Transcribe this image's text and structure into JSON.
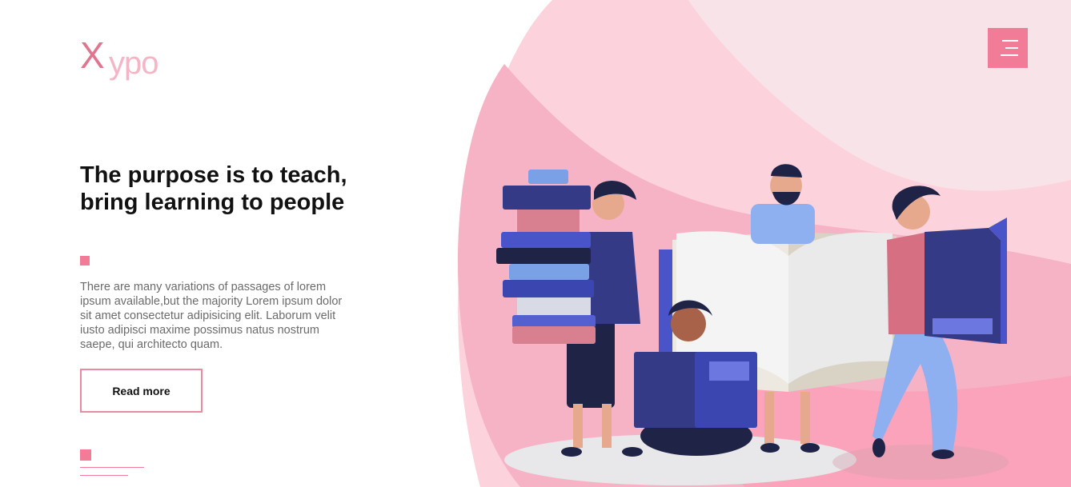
{
  "header": {
    "logo": {
      "letter": "X",
      "rest": "ypo"
    },
    "menu_icon": "hamburger-menu-icon"
  },
  "hero": {
    "title": "The purpose is to teach, bring learning to people",
    "description": "There are many variations of passages of lorem ipsum available,but the majority Lorem ipsum dolor sit amet consectetur adipisicing elit. Laborum velit iusto adipisci maxime possimus natus nostrum saepe, qui architecto quam.",
    "read_more_label": "Read more"
  },
  "colors": {
    "accent": "#f27c98",
    "blob_light": "#f8e4e8",
    "blob_mid": "#fcd3dd",
    "blob_dark": "#f7b3c6",
    "navy": "#343a86"
  },
  "illustration": {
    "subject": "people-reading-books-illustration"
  }
}
